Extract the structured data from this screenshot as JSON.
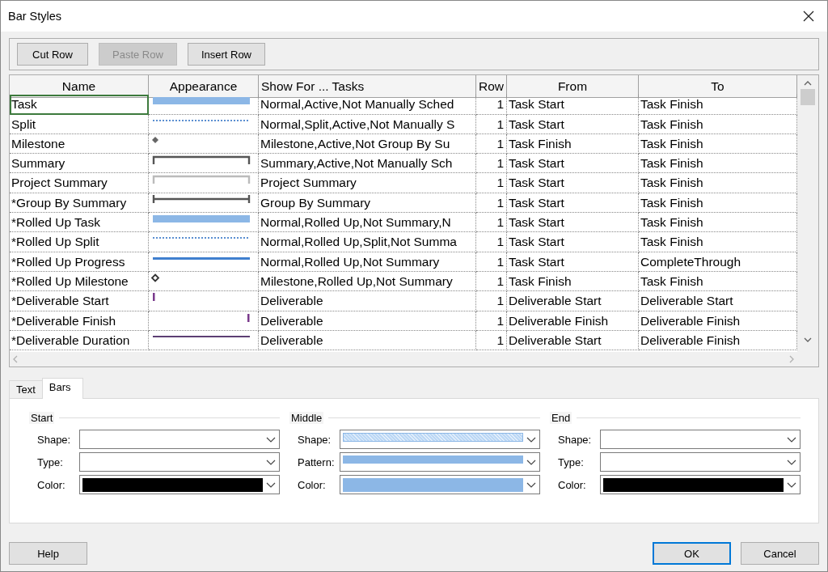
{
  "window": {
    "title": "Bar Styles"
  },
  "toolbar": [
    {
      "label": "Cut Row",
      "disabled": false
    },
    {
      "label": "Paste Row",
      "disabled": true
    },
    {
      "label": "Insert Row",
      "disabled": false
    }
  ],
  "table": {
    "columns": [
      "Name",
      "Appearance",
      "Show For ... Tasks",
      "Row",
      "From",
      "To"
    ],
    "rows": [
      {
        "name": "Task",
        "appearance": {
          "kind": "bar",
          "color": "#8cb7e6"
        },
        "show_for": "Normal,Active,Not Manually Sched",
        "row": "1",
        "from": "Task Start",
        "to": "Task Finish",
        "selected": true
      },
      {
        "name": "Split",
        "appearance": {
          "kind": "dotted",
          "color": "#5b8fd1"
        },
        "show_for": "Normal,Split,Active,Not Manually S",
        "row": "1",
        "from": "Task Start",
        "to": "Task Finish",
        "selected": false
      },
      {
        "name": "Milestone",
        "appearance": {
          "kind": "diamond",
          "color": "#666666"
        },
        "show_for": "Milestone,Active,Not Group By Su",
        "row": "1",
        "from": "Task Finish",
        "to": "Task Finish",
        "selected": false
      },
      {
        "name": "Summary",
        "appearance": {
          "kind": "bracket",
          "color": "#555555"
        },
        "show_for": "Summary,Active,Not Manually Sch",
        "row": "1",
        "from": "Task Start",
        "to": "Task Finish",
        "selected": false
      },
      {
        "name": "Project Summary",
        "appearance": {
          "kind": "bracket",
          "color": "#bbbbbb"
        },
        "show_for": "Project Summary",
        "row": "1",
        "from": "Task Start",
        "to": "Task Finish",
        "selected": false
      },
      {
        "name": "*Group By Summary",
        "appearance": {
          "kind": "capped-line",
          "color": "#555555"
        },
        "show_for": "Group By Summary",
        "row": "1",
        "from": "Task Start",
        "to": "Task Finish",
        "selected": false
      },
      {
        "name": "*Rolled Up Task",
        "appearance": {
          "kind": "bar",
          "color": "#8cb7e6"
        },
        "show_for": "Normal,Rolled Up,Not Summary,N",
        "row": "1",
        "from": "Task Start",
        "to": "Task Finish",
        "selected": false
      },
      {
        "name": "*Rolled Up Split",
        "appearance": {
          "kind": "dotted",
          "color": "#5b8fd1"
        },
        "show_for": "Normal,Rolled Up,Split,Not Summa",
        "row": "1",
        "from": "Task Start",
        "to": "Task Finish",
        "selected": false
      },
      {
        "name": "*Rolled Up Progress",
        "appearance": {
          "kind": "line",
          "color": "#3f7fcf"
        },
        "show_for": "Normal,Rolled Up,Not Summary",
        "row": "1",
        "from": "Task Start",
        "to": "CompleteThrough",
        "selected": false
      },
      {
        "name": "*Rolled Up Milestone",
        "appearance": {
          "kind": "diamond-outline",
          "color": "#333333"
        },
        "show_for": "Milestone,Rolled Up,Not Summary",
        "row": "1",
        "from": "Task Finish",
        "to": "Task Finish",
        "selected": false
      },
      {
        "name": "*Deliverable Start",
        "appearance": {
          "kind": "start-tick",
          "color": "#7a3a8c"
        },
        "show_for": "Deliverable",
        "row": "1",
        "from": "Deliverable Start",
        "to": "Deliverable Start",
        "selected": false
      },
      {
        "name": "*Deliverable Finish",
        "appearance": {
          "kind": "end-tick",
          "color": "#7a3a8c"
        },
        "show_for": "Deliverable",
        "row": "1",
        "from": "Deliverable Finish",
        "to": "Deliverable Finish",
        "selected": false
      },
      {
        "name": "*Deliverable Duration",
        "appearance": {
          "kind": "thin-line",
          "color": "#5d3f73"
        },
        "show_for": "Deliverable",
        "row": "1",
        "from": "Deliverable Start",
        "to": "Deliverable Finish",
        "selected": false
      }
    ]
  },
  "tabs": [
    {
      "label": "Text",
      "selected": false
    },
    {
      "label": "Bars",
      "selected": true
    }
  ],
  "groups": [
    {
      "title": "Start",
      "fields": [
        {
          "label": "Shape:",
          "value": {
            "kind": "empty"
          }
        },
        {
          "label": "Type:",
          "value": {
            "kind": "empty"
          }
        },
        {
          "label": "Color:",
          "value": {
            "kind": "swatch",
            "color": "#000000"
          }
        }
      ]
    },
    {
      "title": "Middle",
      "fields": [
        {
          "label": "Shape:",
          "value": {
            "kind": "hatched-bar",
            "color": "#bcd8f5"
          }
        },
        {
          "label": "Pattern:",
          "value": {
            "kind": "bar",
            "color": "#8cb7e6"
          }
        },
        {
          "label": "Color:",
          "value": {
            "kind": "swatch",
            "color": "#8cb7e6"
          }
        }
      ]
    },
    {
      "title": "End",
      "fields": [
        {
          "label": "Shape:",
          "value": {
            "kind": "empty"
          }
        },
        {
          "label": "Type:",
          "value": {
            "kind": "empty"
          }
        },
        {
          "label": "Color:",
          "value": {
            "kind": "swatch",
            "color": "#000000"
          }
        }
      ]
    }
  ],
  "buttons": [
    {
      "label": "Help",
      "default": false
    },
    {
      "label": "OK",
      "default": true
    },
    {
      "label": "Cancel",
      "default": false
    }
  ]
}
